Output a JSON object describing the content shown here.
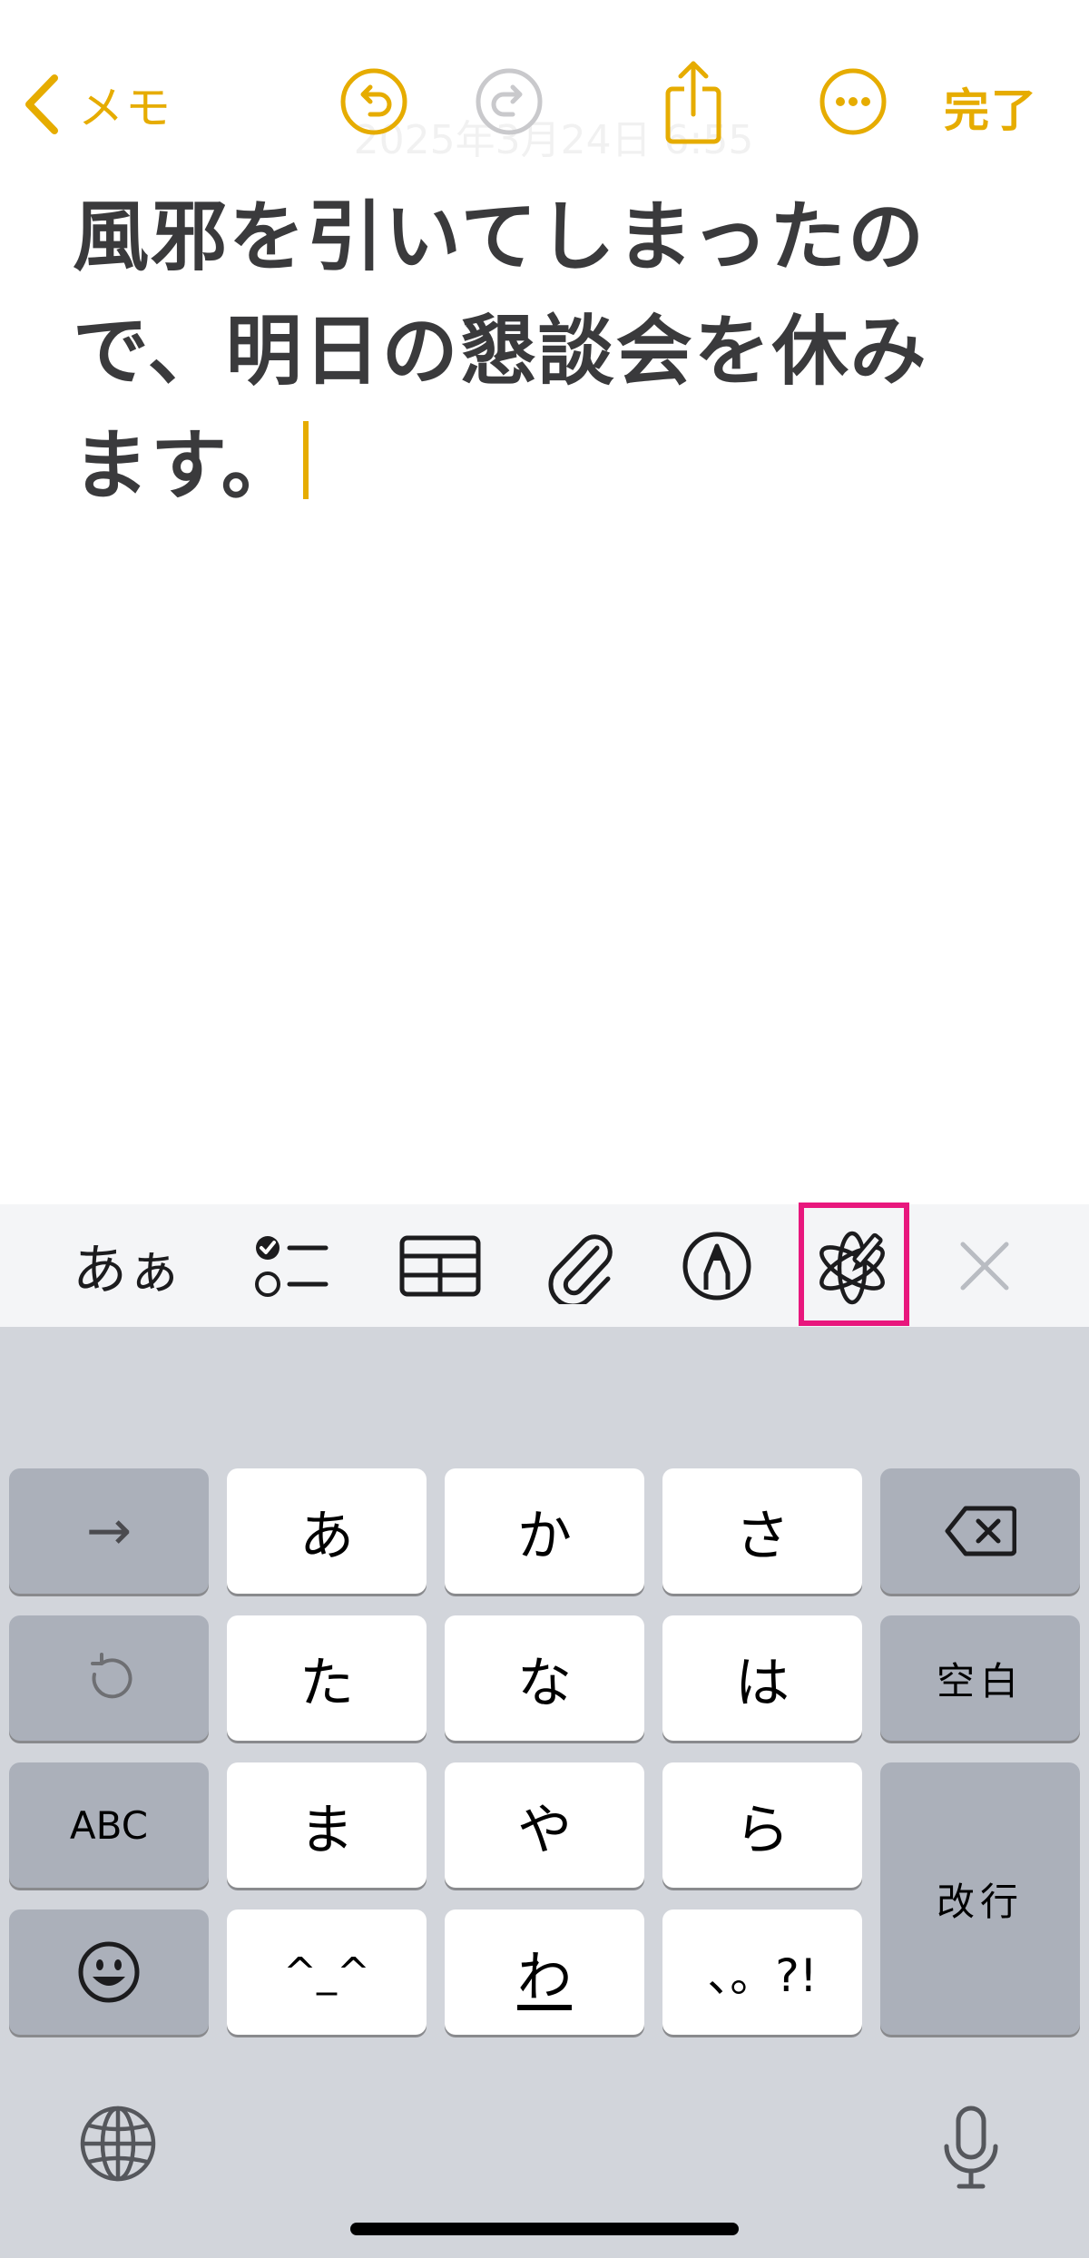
{
  "nav": {
    "back_label": "メモ",
    "date_text": "2025年3月24日 6:55",
    "done_label": "完了"
  },
  "note": {
    "lines": [
      "風邪を引いてしまったの",
      "で、明日の懇談会を休み",
      "ます。"
    ]
  },
  "toolbar": {
    "text_format_label": "あぁ",
    "items": [
      "text-format",
      "checklist",
      "table",
      "attachment",
      "markup",
      "writing-tools",
      "close"
    ],
    "highlighted_item": "writing-tools"
  },
  "keyboard": {
    "row1": {
      "left_key": "→",
      "keys": [
        "あ",
        "か",
        "さ"
      ],
      "right_key": "delete"
    },
    "row2": {
      "left_key": "undo",
      "keys": [
        "た",
        "な",
        "は"
      ],
      "right_key": "空白"
    },
    "row3": {
      "left_key": "ABC",
      "keys": [
        "ま",
        "や",
        "ら"
      ],
      "right_key": "改行"
    },
    "row4": {
      "left_key": "emoji",
      "keys": [
        "^_^",
        "わ",
        "、。?!"
      ]
    }
  },
  "colors": {
    "accent": "#E6AC00",
    "highlight_box": "#E8177D",
    "keyboard_bg": "#d2d5db",
    "key_dark": "#abb0ba",
    "key_light": "#ffffff"
  }
}
